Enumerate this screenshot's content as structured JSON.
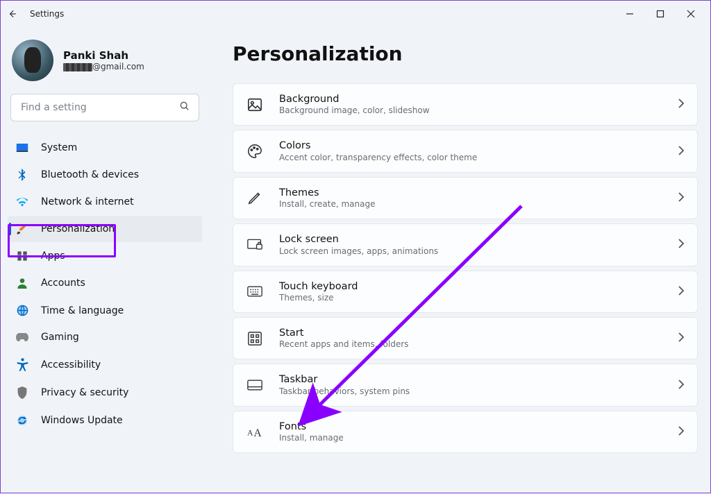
{
  "window": {
    "title": "Settings"
  },
  "profile": {
    "name": "Panki Shah",
    "email_domain": "@gmail.com"
  },
  "search": {
    "placeholder": "Find a setting"
  },
  "sidebar": {
    "items": [
      {
        "label": "System"
      },
      {
        "label": "Bluetooth & devices"
      },
      {
        "label": "Network & internet"
      },
      {
        "label": "Personalization"
      },
      {
        "label": "Apps"
      },
      {
        "label": "Accounts"
      },
      {
        "label": "Time & language"
      },
      {
        "label": "Gaming"
      },
      {
        "label": "Accessibility"
      },
      {
        "label": "Privacy & security"
      },
      {
        "label": "Windows Update"
      }
    ]
  },
  "page": {
    "title": "Personalization",
    "cards": [
      {
        "title": "Background",
        "sub": "Background image, color, slideshow"
      },
      {
        "title": "Colors",
        "sub": "Accent color, transparency effects, color theme"
      },
      {
        "title": "Themes",
        "sub": "Install, create, manage"
      },
      {
        "title": "Lock screen",
        "sub": "Lock screen images, apps, animations"
      },
      {
        "title": "Touch keyboard",
        "sub": "Themes, size"
      },
      {
        "title": "Start",
        "sub": "Recent apps and items, folders"
      },
      {
        "title": "Taskbar",
        "sub": "Taskbar behaviors, system pins"
      },
      {
        "title": "Fonts",
        "sub": "Install, manage"
      }
    ]
  }
}
